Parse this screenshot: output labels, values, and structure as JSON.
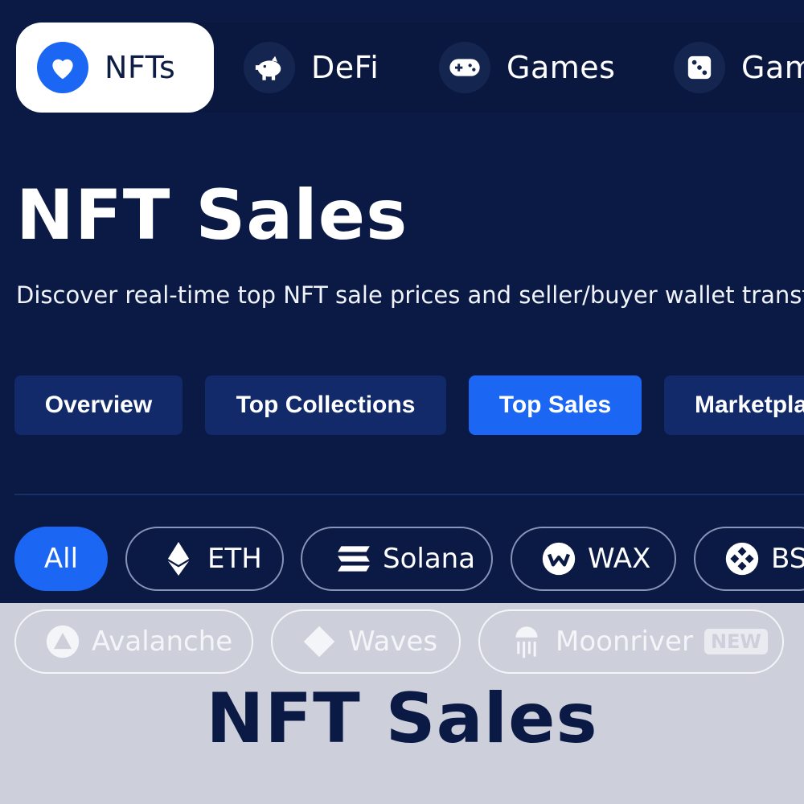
{
  "category_nav": [
    {
      "label": "NFTs",
      "icon": "heart-icon",
      "active": true
    },
    {
      "label": "DeFi",
      "icon": "piggy-bank-icon",
      "active": false
    },
    {
      "label": "Games",
      "icon": "gamepad-icon",
      "active": false
    },
    {
      "label": "Gam",
      "icon": "dice-icon",
      "active": false
    }
  ],
  "header": {
    "title": "NFT Sales",
    "subtitle": "Discover real-time top NFT sale prices and seller/buyer wallet transfe"
  },
  "tabs": [
    {
      "label": "Overview",
      "active": false
    },
    {
      "label": "Top Collections",
      "active": false
    },
    {
      "label": "Top Sales",
      "active": true
    },
    {
      "label": "Marketpla",
      "active": false
    }
  ],
  "chains_row1": [
    {
      "label": "All",
      "icon": "",
      "active": true
    },
    {
      "label": "ETH",
      "icon": "ethereum-icon",
      "active": false
    },
    {
      "label": "Solana",
      "icon": "solana-icon",
      "active": false
    },
    {
      "label": "WAX",
      "icon": "wax-icon",
      "active": false
    },
    {
      "label": "BS",
      "icon": "bnb-icon",
      "active": false
    }
  ],
  "chains_row2": [
    {
      "label": "Avalanche",
      "icon": "avalanche-icon"
    },
    {
      "label": "Waves",
      "icon": "waves-icon"
    },
    {
      "label": "Moonriver",
      "icon": "moonriver-icon",
      "badge": "NEW"
    }
  ],
  "banner_title": "NFT Sales",
  "colors": {
    "background": "#0b1a45",
    "accent": "#1b66f2",
    "tab_bg": "#12296a",
    "bottom_panel": "#cdd0db"
  }
}
